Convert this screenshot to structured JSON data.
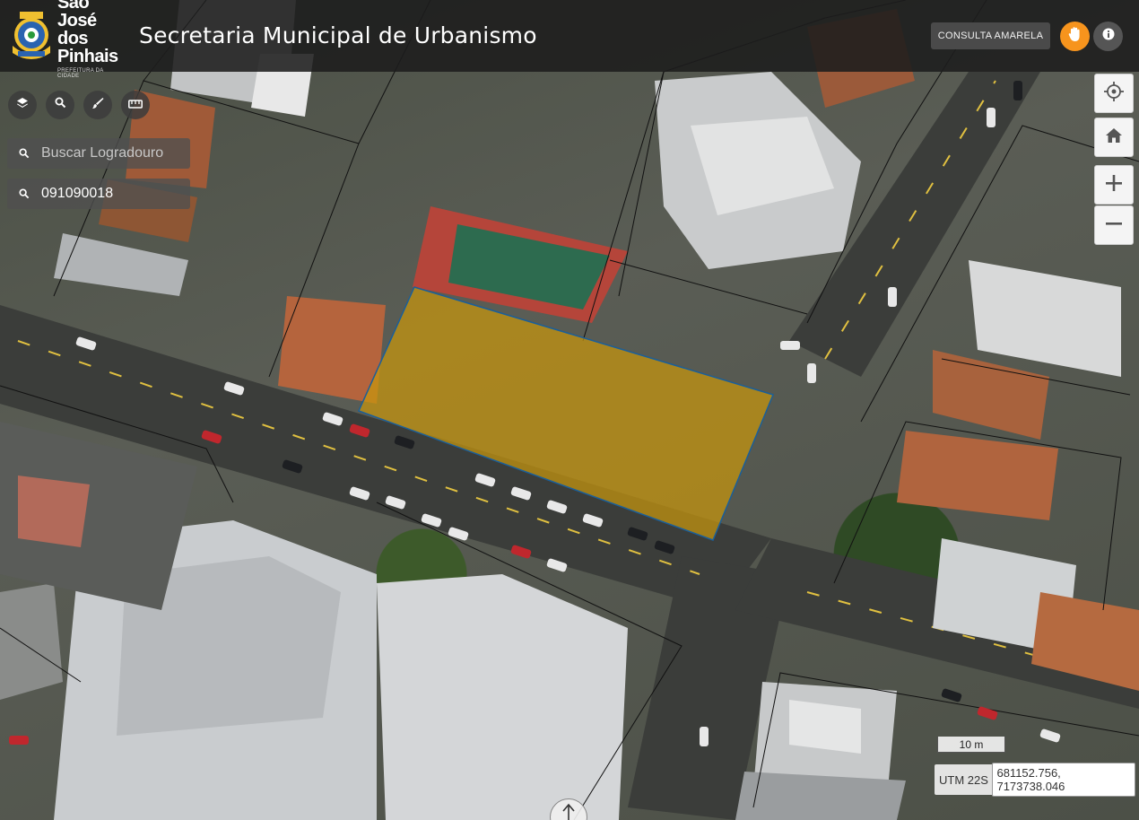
{
  "header": {
    "logo_name_line1": "São José",
    "logo_name_line2": "dos Pinhais",
    "logo_subtitle": "PREFEITURA DA CIDADE",
    "title": "Secretaria Municipal de Urbanismo",
    "consulta_button": "CONSULTA AMARELA",
    "hand_icon": "hand-icon",
    "info_icon": "info-icon"
  },
  "tools": [
    {
      "name": "layers-icon"
    },
    {
      "name": "search-icon"
    },
    {
      "name": "brush-icon"
    },
    {
      "name": "ruler-icon"
    }
  ],
  "search": {
    "street_placeholder": "Buscar Logradouro",
    "street_value": "",
    "parcel_placeholder": "",
    "parcel_value": "091090018"
  },
  "map_controls": [
    "locate-icon",
    "home-icon",
    "zoom-in-icon",
    "zoom-out-icon"
  ],
  "scale_label": "10 m",
  "coordinates": {
    "zone": "UTM 22S",
    "value": "681152.756, 7173738.046"
  },
  "colors": {
    "accent_orange": "#f7941d",
    "selection_fill": "#c8960c",
    "header_bg": "#1c1c1c"
  }
}
